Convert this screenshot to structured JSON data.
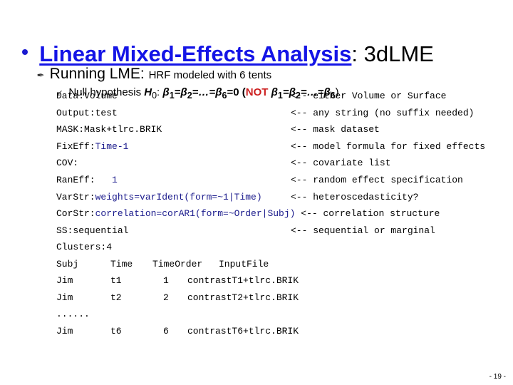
{
  "slide": {
    "title": {
      "link_text": "Linear Mixed-Effects Analysis",
      "rest": ": 3dLME"
    },
    "level2": {
      "big": "Running LME:",
      "small": "HRF modeled with 6 tents",
      "bullet_icon": "pen-bullet"
    },
    "level3": {
      "bullet_icon": "arrow-bullet",
      "prefix": "Null hypothesis ",
      "h0": "H",
      "h0_sub": "0",
      "colon": ": ",
      "eq1": "β",
      "s1": "1",
      "eq2": "=β",
      "s2": "2",
      "eq3": "=…=β",
      "s6": "6",
      "eq4": "=0 (",
      "not": "NOT",
      "eq5": " β",
      "t1": "1",
      "eq6": "=β",
      "t2": "2",
      "eq7": "=…=β",
      "t6": "6",
      "eq8": ")"
    },
    "params": [
      {
        "key": "Data:",
        "value": "Volume",
        "value_blue": false,
        "comment": "<-- either Volume or Surface"
      },
      {
        "key": "Output:",
        "value": "test",
        "value_blue": false,
        "comment": "<-- any string (no suffix needed)"
      },
      {
        "key": "MASK:",
        "value": "Mask+tlrc.BRIK",
        "value_blue": false,
        "comment": "<-- mask dataset"
      },
      {
        "key": "FixEff:",
        "value": "Time-1",
        "value_blue": true,
        "comment": "<-- model formula for fixed effects"
      },
      {
        "key": "COV:",
        "value": "",
        "value_blue": false,
        "comment": "<-- covariate list"
      },
      {
        "key": "RanEff:",
        "value": "   1",
        "value_blue": true,
        "comment": "<-- random effect specification"
      },
      {
        "key": "VarStr:",
        "value": "weights=varIdent(form=~1|Time)",
        "value_blue": true,
        "comment": "<-- heteroscedasticity?"
      },
      {
        "key": "CorStr:",
        "value": "correlation=corAR1(form=~Order|Subj)",
        "value_blue": true,
        "comment": "<-- correlation structure"
      },
      {
        "key": "SS:",
        "value": "sequential",
        "value_blue": false,
        "comment": "<-- sequential or marginal"
      },
      {
        "key": "Clusters:",
        "value": "4",
        "value_blue": false,
        "comment": ""
      }
    ],
    "table": {
      "headers": [
        "Subj",
        "Time",
        "TimeOrder",
        "InputFile"
      ],
      "rows": [
        [
          "Jim",
          "t1",
          "1",
          "contrastT1+tlrc.BRIK"
        ],
        [
          "Jim",
          "t2",
          "2",
          "contrastT2+tlrc.BRIK"
        ],
        [
          "......",
          "",
          "",
          ""
        ],
        [
          "Jim",
          "t6",
          "6",
          "contrastT6+tlrc.BRIK"
        ]
      ]
    },
    "page_number": "- 19 -"
  },
  "colors": {
    "title_link": "#1414e6",
    "not_red": "#cc1f1f",
    "code_blue": "#1a1a8c"
  }
}
